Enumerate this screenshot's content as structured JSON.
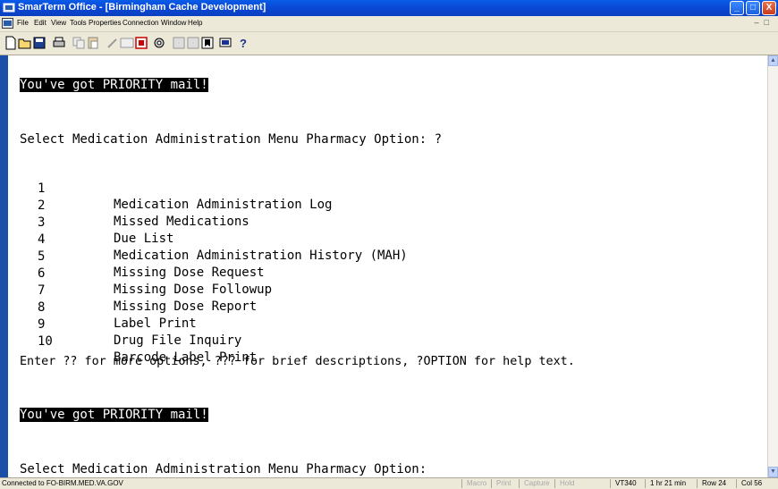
{
  "window": {
    "title": "SmarTerm Office - [Birmingham Cache Development]",
    "buttons": {
      "minimize": "_",
      "maximize": "□",
      "close": "X"
    }
  },
  "menu": [
    "File",
    "Edit",
    "View",
    "Tools",
    "Properties",
    "Connection",
    "Window",
    "Help"
  ],
  "terminal": {
    "mail_notice_1": "You've got PRIORITY mail!",
    "prompt_1": "Select Medication Administration Menu Pharmacy Option: ?",
    "options": [
      {
        "num": "1",
        "label": "Medication Administration Log"
      },
      {
        "num": "2",
        "label": "Missed Medications"
      },
      {
        "num": "3",
        "label": "Due List"
      },
      {
        "num": "4",
        "label": "Medication Administration History (MAH)"
      },
      {
        "num": "5",
        "label": "Missing Dose Request"
      },
      {
        "num": "6",
        "label": "Missing Dose Followup"
      },
      {
        "num": "7",
        "label": "Missing Dose Report"
      },
      {
        "num": "8",
        "label": "Label Print"
      },
      {
        "num": "9",
        "label": "Drug File Inquiry"
      },
      {
        "num": "10",
        "label": "Barcode Label Print"
      }
    ],
    "help_line": "Enter ?? for more options, ??? for brief descriptions, ?OPTION for help text.",
    "mail_notice_2": "You've got PRIORITY mail!",
    "prompt_2": "Select Medication Administration Menu Pharmacy Option:"
  },
  "status": {
    "connection": "Connected to FO-BIRM.MED.VA.GOV",
    "macro": "Macro",
    "print": "Print",
    "capture": "Capture",
    "hold": "Hold",
    "emulation": "VT340",
    "session_time": "1 hr 21 min",
    "row": "Row 24",
    "col": "Col 56"
  }
}
